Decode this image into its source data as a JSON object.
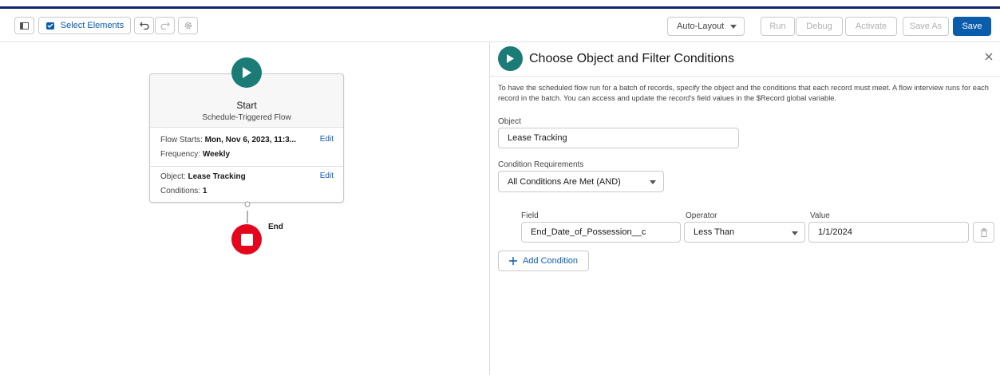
{
  "toolbar": {
    "select_elements_label": "Select Elements",
    "auto_layout_label": "Auto-Layout",
    "run_label": "Run",
    "debug_label": "Debug",
    "activate_label": "Activate",
    "save_as_label": "Save As",
    "save_label": "Save"
  },
  "canvas": {
    "start_card": {
      "title": "Start",
      "subtitle": "Schedule-Triggered Flow",
      "flow_starts_label": "Flow Starts:",
      "flow_starts_value": "Mon, Nov 6, 2023, 11:3...",
      "frequency_label": "Frequency:",
      "frequency_value": "Weekly",
      "object_label": "Object:",
      "object_value": "Lease Tracking",
      "conditions_label": "Conditions:",
      "conditions_value": "1",
      "edit_label_1": "Edit",
      "edit_label_2": "Edit"
    },
    "end_label": "End"
  },
  "panel": {
    "title": "Choose Object and Filter Conditions",
    "description": "To have the scheduled flow run for a batch of records, specify the object and the conditions that each record must meet. A flow interview runs for each record in the batch. You can access and update the record's field values in the $Record global variable.",
    "object_label": "Object",
    "object_value": "Lease Tracking",
    "condition_requirements_label": "Condition Requirements",
    "condition_requirements_value": "All Conditions Are Met (AND)",
    "field_header": "Field",
    "operator_header": "Operator",
    "value_header": "Value",
    "condition": {
      "field": "End_Date_of_Possession__c",
      "operator": "Less Than",
      "value": "1/1/2024"
    },
    "add_condition_label": "Add Condition"
  },
  "colors": {
    "brand_blue": "#0b5cab",
    "start_teal": "#1b7c77",
    "end_red": "#e3061d"
  }
}
